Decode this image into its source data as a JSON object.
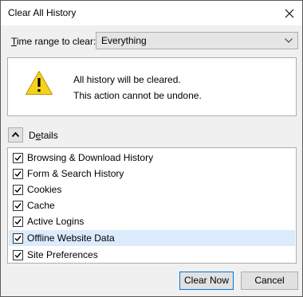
{
  "dialog": {
    "title": "Clear All History"
  },
  "time_range": {
    "label_underlined": "T",
    "label_rest": "ime range to clear:",
    "selected": "Everything"
  },
  "warning": {
    "line1": "All history will be cleared.",
    "line2": "This action cannot be undone."
  },
  "details": {
    "label_first": "D",
    "label_underlined": "e",
    "label_rest": "tails",
    "expanded": true
  },
  "items": [
    {
      "label": "Browsing & Download History",
      "checked": true
    },
    {
      "label": "Form & Search History",
      "checked": true
    },
    {
      "label": "Cookies",
      "checked": true
    },
    {
      "label": "Cache",
      "checked": true
    },
    {
      "label": "Active Logins",
      "checked": true
    },
    {
      "label": "Offline Website Data",
      "checked": true
    },
    {
      "label": "Site Preferences",
      "checked": true
    }
  ],
  "buttons": {
    "clear": "Clear Now",
    "cancel": "Cancel"
  },
  "colors": {
    "highlight": "#dcebfc",
    "focus_border": "#0078d7",
    "warning_yellow": "#f8d21a"
  },
  "icons": {
    "close": "close-icon",
    "dropdown": "chevron-down-icon",
    "warning": "warning-icon",
    "details_toggle": "chevron-up-icon",
    "checkbox": "check-icon"
  }
}
